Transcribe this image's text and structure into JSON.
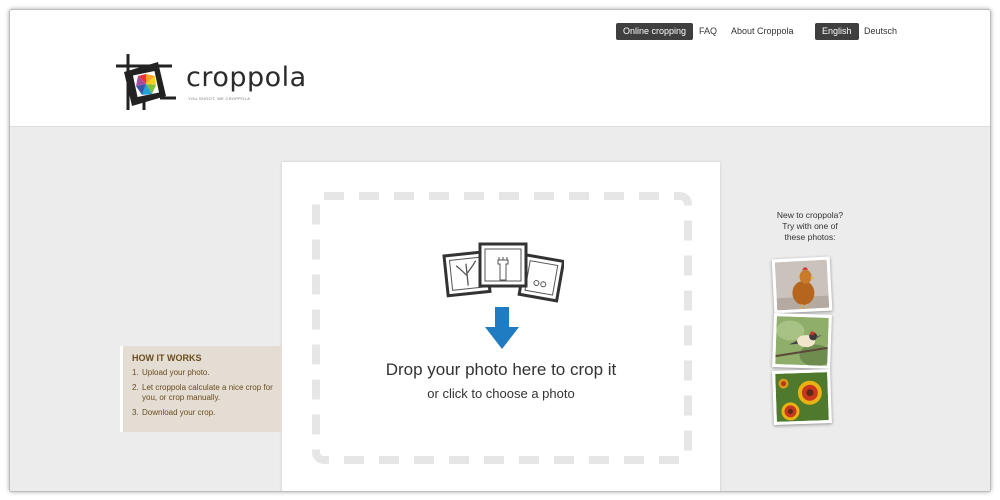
{
  "nav": {
    "online_cropping": "Online cropping",
    "faq": "FAQ",
    "about": "About Croppola",
    "english": "English",
    "deutsch": "Deutsch"
  },
  "logo": {
    "wordmark": "croppola",
    "tagline": "YOU SHOOT, WE CROPPOLA"
  },
  "dropzone": {
    "title": "Drop your photo here to crop it",
    "subtitle": "or click to choose a photo"
  },
  "how_it_works": {
    "title": "HOW IT WORKS",
    "steps": [
      {
        "num": "1.",
        "text": "Upload your photo."
      },
      {
        "num": "2.",
        "text": "Let croppola calculate a nice crop for you, or crop manually."
      },
      {
        "num": "3.",
        "text": "Download your crop."
      }
    ]
  },
  "samples": {
    "heading_line1": "New to croppola?",
    "heading_line2": "Try with one of",
    "heading_line3": "these photos:",
    "photos": [
      "rooster",
      "bird",
      "flowers"
    ]
  },
  "colors": {
    "nav_active": "#3f3f3f",
    "arrow": "#1f7bc2",
    "how_bg": "#e3ddd3",
    "how_text": "#6b4c1e",
    "page_bg": "#ececec"
  }
}
